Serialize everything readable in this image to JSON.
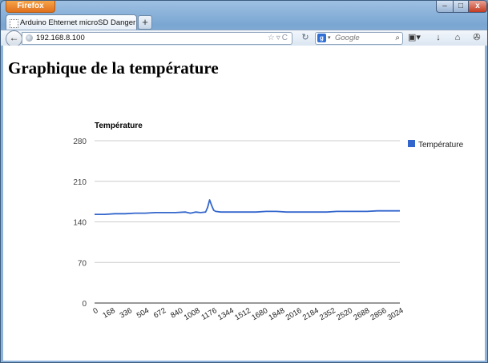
{
  "window": {
    "app_button": "Firefox",
    "min_glyph": "–",
    "max_glyph": "□",
    "close_glyph": "x"
  },
  "tab": {
    "title": "Arduino Ehternet microSD Danger",
    "new_tab_glyph": "+"
  },
  "navbar": {
    "back_glyph": "←",
    "url": "192.168.8.100",
    "url_icons": "☆▿C",
    "reload_glyph": "↻",
    "search_engine": "g",
    "search_dropdown": "▾",
    "search_placeholder": "Google",
    "search_glyph": "⌕",
    "bookmarks_glyph": "▣▾",
    "download_glyph": "↓",
    "home_glyph": "⌂",
    "addon_glyph": "✇"
  },
  "page": {
    "heading": "Graphique de la température"
  },
  "colors": {
    "series": "#3366cc",
    "grid": "#cccccc",
    "axis": "#333333"
  },
  "chart_data": {
    "type": "line",
    "title": "Température",
    "xlabel": "",
    "ylabel": "",
    "legend_position": "right",
    "grid": true,
    "xlim": [
      0,
      3024
    ],
    "ylim": [
      0,
      280
    ],
    "y_ticks": [
      "0",
      "70",
      "140",
      "210",
      "280"
    ],
    "x_ticks": [
      "0",
      "168",
      "336",
      "504",
      "672",
      "840",
      "1008",
      "1176",
      "1344",
      "1512",
      "1680",
      "1848",
      "2016",
      "2184",
      "2352",
      "2520",
      "2688",
      "2856",
      "3024"
    ],
    "series": [
      {
        "name": "Température",
        "x": [
          0,
          100,
          200,
          300,
          400,
          500,
          600,
          700,
          800,
          900,
          950,
          1000,
          1050,
          1100,
          1120,
          1140,
          1160,
          1180,
          1200,
          1250,
          1300,
          1400,
          1500,
          1600,
          1700,
          1800,
          1900,
          2000,
          2100,
          2200,
          2300,
          2400,
          2500,
          2600,
          2700,
          2800,
          2900,
          3000,
          3024
        ],
        "y": [
          153,
          153,
          154,
          154,
          155,
          155,
          156,
          156,
          156,
          157,
          155,
          157,
          156,
          157,
          165,
          178,
          168,
          160,
          158,
          157,
          157,
          157,
          157,
          157,
          158,
          158,
          157,
          157,
          157,
          157,
          157,
          158,
          158,
          158,
          158,
          159,
          159,
          159,
          159
        ]
      }
    ]
  }
}
